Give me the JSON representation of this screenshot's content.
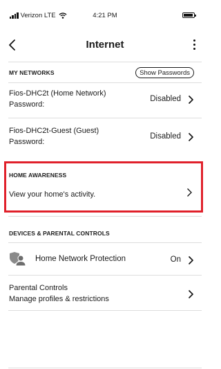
{
  "status_bar": {
    "carrier": "Verizon",
    "network": "LTE",
    "time": "4:21 PM"
  },
  "nav": {
    "title": "Internet"
  },
  "my_networks": {
    "header": "MY NETWORKS",
    "show_passwords_label": "Show Passwords",
    "items": [
      {
        "name": "Fios-DHC2t (Home Network)",
        "sub": "Password:",
        "status": "Disabled"
      },
      {
        "name": "Fios-DHC2t-Guest (Guest)",
        "sub": "Password:",
        "status": "Disabled"
      }
    ]
  },
  "home_awareness": {
    "header": "HOME AWARENESS",
    "item": "View your home's activity."
  },
  "devices": {
    "header": "DEVICES & PARENTAL CONTROLS",
    "protection": {
      "label": "Home Network Protection",
      "status": "On"
    },
    "parental": {
      "title": "Parental Controls",
      "sub": "Manage profiles & restrictions"
    }
  },
  "icons": [
    "signal-icon",
    "wifi-icon",
    "battery-icon",
    "back-chevron-icon",
    "more-icon",
    "chevron-right-icon",
    "shield-user-icon"
  ],
  "colors": {
    "highlight": "#e0202a",
    "text": "#1a1a1a",
    "divider": "#dddddd"
  }
}
